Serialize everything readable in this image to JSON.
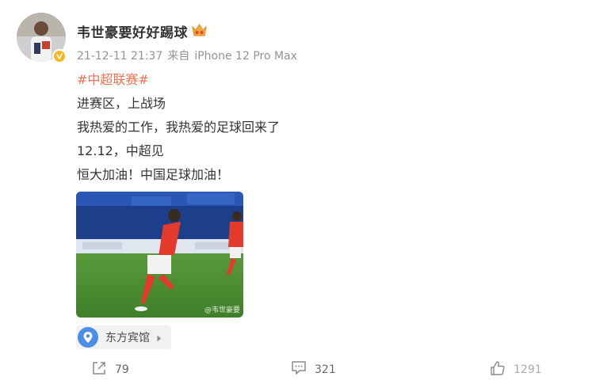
{
  "user": {
    "name": "韦世豪要好好踢球",
    "verified_color": "#f6b521",
    "badge_icon": "vip-crown-icon"
  },
  "meta": {
    "timestamp": "21-12-11 21:37",
    "source_prefix": "来自",
    "device": "iPhone 12 Pro Max"
  },
  "content": {
    "hashtag": "#中超联赛#",
    "lines": [
      "进赛区，上战场",
      "我热爱的工作，我热爱的足球回来了",
      "12.12，中超见",
      "恒大加油！中国足球加油！"
    ]
  },
  "photo": {
    "watermark": "@韦世豪要"
  },
  "location": {
    "label": "东方宾馆",
    "icon": "location-pin-icon"
  },
  "actions": {
    "share_count": "79",
    "comment_count": "321",
    "like_count": "1291"
  },
  "colors": {
    "hashtag": "#eb7350",
    "location_icon_bg": "#4c8de8"
  }
}
